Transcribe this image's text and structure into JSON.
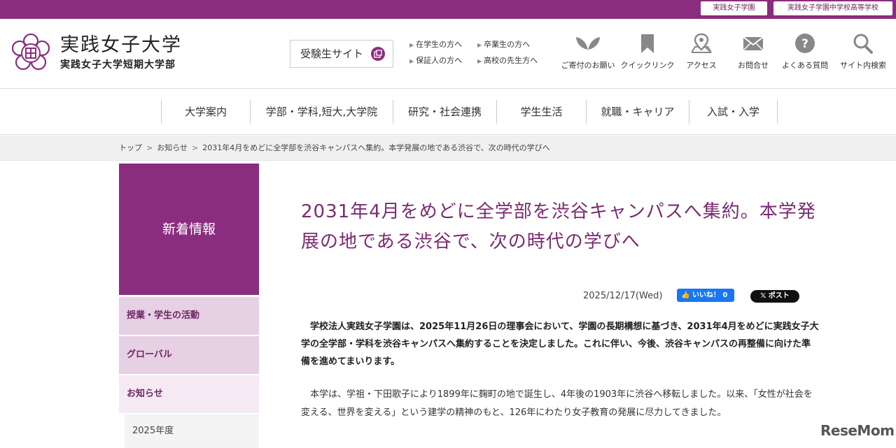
{
  "topbar": {
    "links": [
      "実践女子学園",
      "実践女子学園中学校高等学校"
    ]
  },
  "header": {
    "logo_main": "実践女子大学",
    "logo_sub": "実践女子大学短期大学部",
    "exam_site": "受験生サイト",
    "sublinks": [
      "在学生の方へ",
      "卒業生の方へ",
      "保証人の方へ",
      "高校の先生方へ"
    ],
    "icons": [
      {
        "label": "ご寄付のお願い",
        "icon": "leaf-icon"
      },
      {
        "label": "クイックリンク",
        "icon": "bookmark-icon"
      },
      {
        "label": "アクセス",
        "icon": "map-pin-icon"
      },
      {
        "label": "お問合せ",
        "icon": "mail-icon"
      },
      {
        "label": "よくある質問",
        "icon": "question-icon"
      },
      {
        "label": "サイト内検索",
        "icon": "search-icon"
      }
    ]
  },
  "nav": {
    "items": [
      "大学案内",
      "学部・学科,短大,大学院",
      "研究・社会連携",
      "学生生活",
      "就職・キャリア",
      "入試・入学"
    ]
  },
  "breadcrumb": {
    "items": [
      "トップ",
      "お知らせ",
      "2031年4月をめどに全学部を渋谷キャンパスへ集約。本学発展の地である渋谷で、次の時代の学びへ"
    ]
  },
  "sidebar": {
    "heading": "新着情報",
    "items": [
      "授業・学生の活動",
      "グローバル",
      "お知らせ"
    ],
    "sub_item": "2025年度"
  },
  "article": {
    "title": "2031年4月をめどに全学部を渋谷キャンパスへ集約。本学発展の地である渋谷で、次の時代の学びへ",
    "date": "2025/12/17(Wed)",
    "fb_label": "いいね！ 0",
    "x_label": "ポスト",
    "lead": "学校法人実践女子学園は、2025年11月26日の理事会において、学園の長期構想に基づき、2031年4月をめどに実践女子大学の全学部・学科を渋谷キャンパスへ集約することを決定しました。これに伴い、今後、渋谷キャンパスの再整備に向けた準備を進めてまいります。",
    "paragraph": "本学は、学祖・下田歌子により1899年に麹町の地で誕生し、4年後の1903年に渋谷へ移転しました。以来、「女性が社会を変える、世界を変える」という建学の精神のもと、126年にわたり女子教育の発展に尽力してきました。"
  },
  "watermark": "ReseMom",
  "colors": {
    "brand": "#8a2d7e",
    "sidebar_light": "#e6d0e3",
    "title": "#7a2b70"
  }
}
